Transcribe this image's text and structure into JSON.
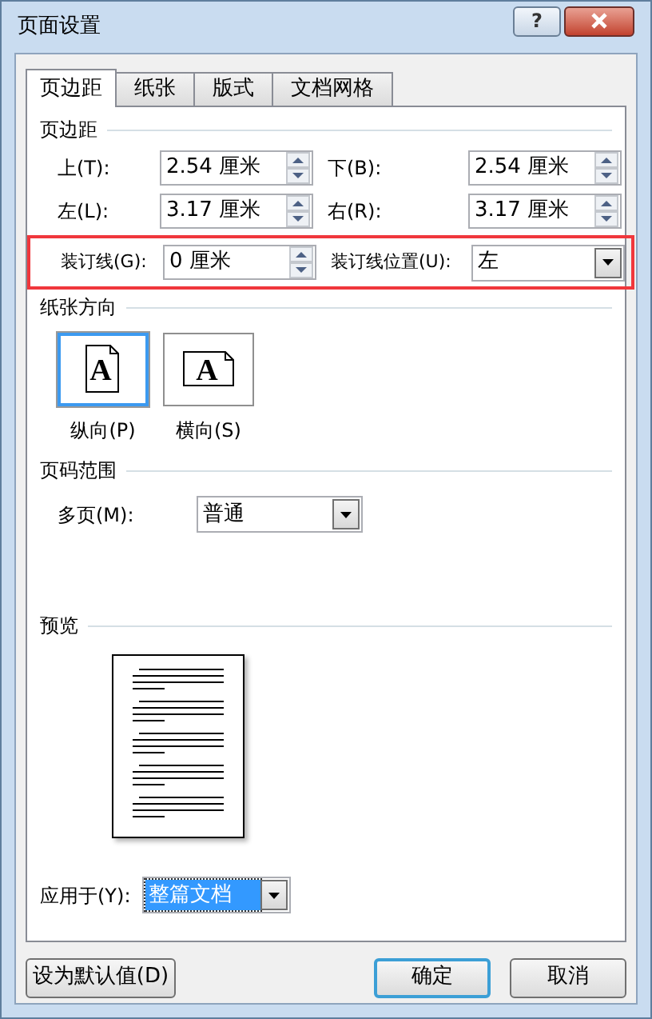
{
  "window": {
    "title": "页面设置",
    "help": "?"
  },
  "tabs": [
    {
      "label": "页边距",
      "selected": true
    },
    {
      "label": "纸张",
      "selected": false
    },
    {
      "label": "版式",
      "selected": false
    },
    {
      "label": "文档网格",
      "selected": false
    }
  ],
  "margins": {
    "title": "页边距",
    "fields": [
      {
        "label": "上(T):",
        "value": "2.54 厘米"
      },
      {
        "label": "下(B):",
        "value": "2.54 厘米"
      },
      {
        "label": "左(L):",
        "value": "3.17 厘米"
      },
      {
        "label": "右(R):",
        "value": "3.17 厘米"
      }
    ]
  },
  "gutter": {
    "highlighted": true,
    "label": "装订线(G):",
    "value": "0 厘米",
    "position_label": "装订线位置(U):",
    "position_value": "左"
  },
  "orientation": {
    "title": "纸张方向",
    "options": [
      {
        "label": "纵向(P)",
        "kind": "portrait",
        "selected": true,
        "icon_letter": "A"
      },
      {
        "label": "横向(S)",
        "kind": "landscape",
        "selected": false,
        "icon_letter": "A"
      }
    ]
  },
  "pages": {
    "title": "页码范围",
    "label": "多页(M):",
    "value": "普通"
  },
  "preview": {
    "title": "预览"
  },
  "apply": {
    "label": "应用于(Y):",
    "value": "整篇文档",
    "focused": true
  },
  "buttons": [
    {
      "label": "设为默认值(D)",
      "default": false
    },
    {
      "label": "确定",
      "default": true
    },
    {
      "label": "取消",
      "default": false
    }
  ]
}
